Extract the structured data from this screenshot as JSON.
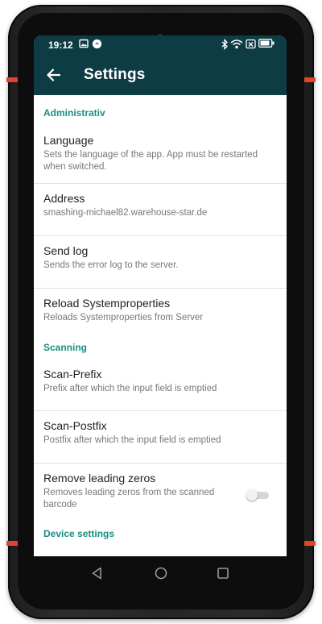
{
  "status_bar": {
    "time": "19:12"
  },
  "app_bar": {
    "title": "Settings"
  },
  "sections": [
    {
      "header": "Administrativ",
      "items": [
        {
          "title": "Language",
          "subtitle": "Sets the language of the app. App must be restarted when switched."
        },
        {
          "title": "Address",
          "subtitle": "smashing-michael82.warehouse-star.de"
        },
        {
          "title": "Send log",
          "subtitle": "Sends the error log to the server."
        },
        {
          "title": "Reload Systemproperties",
          "subtitle": "Reloads Systemproperties from Server"
        }
      ]
    },
    {
      "header": "Scanning",
      "items": [
        {
          "title": "Scan-Prefix",
          "subtitle": "Prefix after which the input field is emptied"
        },
        {
          "title": "Scan-Postfix",
          "subtitle": "Postfix after which the input field is emptied"
        },
        {
          "title": "Remove leading zeros",
          "subtitle": "Removes leading zeros from the scanned barcode",
          "toggle_on": false
        }
      ]
    },
    {
      "header": "Device settings",
      "items": []
    }
  ],
  "colors": {
    "primary_dark": "#0e3c45",
    "section_accent": "#1b8e83",
    "device_accent": "#e0452e"
  },
  "icons": {
    "status_left": [
      "image-icon",
      "app-notification-icon"
    ],
    "status_right": [
      "bluetooth-icon",
      "wifi-icon",
      "sim-icon",
      "battery-icon"
    ],
    "nav": [
      "nav-back-icon",
      "nav-home-icon",
      "nav-recents-icon"
    ]
  }
}
